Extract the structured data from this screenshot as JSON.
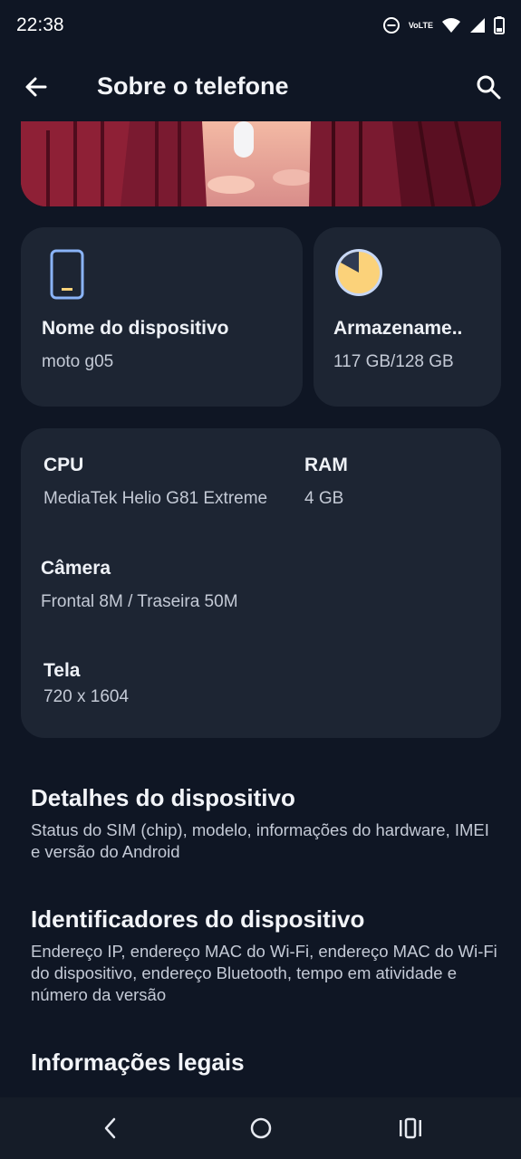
{
  "status_bar": {
    "time": "22:38",
    "volte_top": "Vo",
    "volte_bottom": "LTE"
  },
  "header": {
    "title": "Sobre o telefone"
  },
  "tiles": {
    "device": {
      "title": "Nome do dispositivo",
      "value": "moto g05",
      "icon": "phone-icon"
    },
    "storage": {
      "title": "Armazename..",
      "value": "117 GB/128 GB",
      "icon": "storage-pie-icon"
    }
  },
  "specs": {
    "cpu": {
      "label": "CPU",
      "value": "MediaTek Helio G81 Extreme"
    },
    "ram": {
      "label": "RAM",
      "value": "4 GB"
    },
    "camera": {
      "label": "Câmera",
      "value": "Frontal 8M / Traseira 50M"
    },
    "screen": {
      "label": "Tela",
      "value": "720 x 1604"
    }
  },
  "menu": [
    {
      "title": "Detalhes do dispositivo",
      "description": "Status do SIM (chip), modelo, informações do hardware, IMEI e versão do Android"
    },
    {
      "title": "Identificadores do dispositivo",
      "description": "Endereço IP, endereço MAC do Wi-Fi, endereço MAC do Wi-Fi do dispositivo, endereço Bluetooth, tempo em atividade e número da versão"
    },
    {
      "title": "Informações legais"
    }
  ],
  "colors": {
    "background": "#0f1624",
    "card": "#1d2533",
    "accent_blue": "#8ab4f8",
    "accent_yellow": "#fbd27a"
  }
}
